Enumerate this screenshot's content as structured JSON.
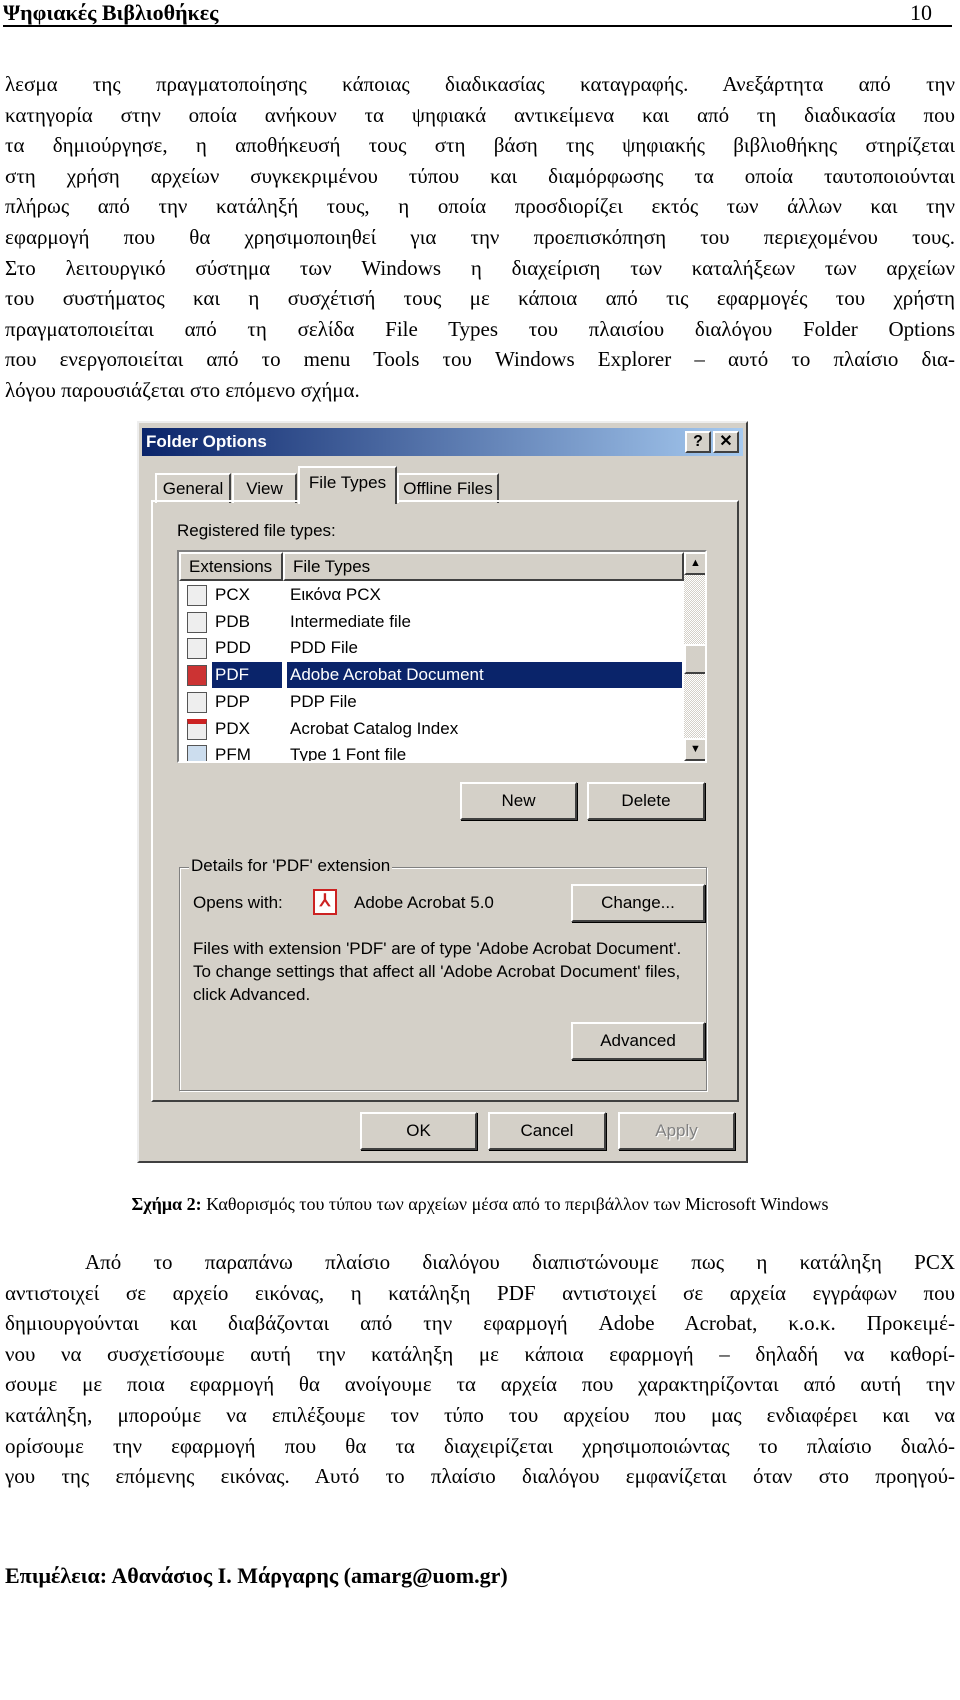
{
  "header": {
    "title": "Ψηφιακές Βιβλιοθήκες",
    "page_number": "10"
  },
  "paragraph1": [
    "λεσμα της πραγματοποίησης κάποιας διαδικασίας καταγραφής. Ανεξάρτητα από την",
    "κατηγορία στην οποία ανήκουν τα ψηφιακά αντικείμενα και από τη διαδικασία που",
    "τα δημιούργησε, η αποθήκευσή τους στη βάση της ψηφιακής βιβλιοθήκης στηρίζεται",
    "στη χρήση αρχείων συγκεκριμένου τύπου και διαμόρφωσης τα οποία ταυτοποιούνται",
    "πλήρως από την κατάληξή τους, η οποία προσδιορίζει εκτός των άλλων και την",
    "εφαρμογή που θα χρησιμοποιηθεί για την προεπισκόπηση του περιεχομένου τους.",
    "Στο λειτουργικό σύστημα των Windows η διαχείριση των καταλήξεων των αρχείων",
    "του συστήματος και η συσχέτισή τους με κάποια από τις εφαρμογές του χρήστη",
    "πραγματοποιείται από τη σελίδα File Types του πλαισίου διαλόγου Folder Options",
    "που ενεργοποιείται από το menu Tools του Windows Explorer – αυτό το πλαίσιο δια-",
    "λόγου παρουσιάζεται στο επόμενο σχήμα."
  ],
  "dialog": {
    "title": "Folder Options",
    "help_label": "?",
    "close_label": "✕",
    "tabs": [
      {
        "label": "General"
      },
      {
        "label": "View"
      },
      {
        "label": "File Types",
        "selected": true
      },
      {
        "label": "Offline Files"
      }
    ],
    "registered_label": "Registered file types:",
    "columns": [
      "Extensions",
      "File Types"
    ],
    "rows": [
      {
        "ext": "PCX",
        "type": "Εικόνα PCX",
        "icon": "image-file-icon"
      },
      {
        "ext": "PDB",
        "type": "Intermediate file",
        "icon": "generic-file-icon"
      },
      {
        "ext": "PDD",
        "type": "PDD File",
        "icon": "checked-file-icon"
      },
      {
        "ext": "PDF",
        "type": "Adobe Acrobat Document",
        "icon": "acrobat-document-icon",
        "selected": true
      },
      {
        "ext": "PDP",
        "type": "PDP File",
        "icon": "acrobat-file-icon"
      },
      {
        "ext": "PDX",
        "type": "Acrobat Catalog Index",
        "icon": "catalog-index-icon"
      },
      {
        "ext": "PFM",
        "type": "Type 1 Font file",
        "icon": "font-file-icon"
      }
    ],
    "new_label": "New",
    "delete_label": "Delete",
    "details_label": "Details for 'PDF' extension",
    "opens_with_label": "Opens with:",
    "opens_with_app": "Adobe Acrobat 5.0",
    "change_label": "Change...",
    "description": [
      "Files with extension 'PDF' are of type 'Adobe Acrobat Document'.",
      "To change settings that affect all 'Adobe Acrobat Document' files,",
      "click Advanced."
    ],
    "advanced_label": "Advanced",
    "ok_label": "OK",
    "cancel_label": "Cancel",
    "apply_label": "Apply",
    "selection_color": "#0a246a"
  },
  "caption": {
    "label": "Σχήμα 2:",
    "text": " Καθορισμός του τύπου των αρχείων μέσα από το περιβάλλον των Microsoft Windows"
  },
  "paragraph2": [
    "Από το παραπάνω πλαίσιο διαλόγου διαπιστώνουμε πως η κατάληξη PCX",
    "αντιστοιχεί σε αρχείο εικόνας, η κατάληξη PDF αντιστοιχεί σε αρχεία εγγράφων που",
    "δημιουργούνται και διαβάζονται από την εφαρμογή Adobe Acrobat, κ.ο.κ. Προκειμέ-",
    "νου να συσχετίσουμε αυτή την κατάληξη με κάποια εφαρμογή – δηλαδή να καθορί-",
    "σουμε με ποια εφαρμογή θα ανοίγουμε τα αρχεία που χαρακτηρίζονται από αυτή την",
    "κατάληξη, μπορούμε να επιλέξουμε τον τύπο του αρχείου που μας ενδιαφέρει και να",
    "ορίσουμε την εφαρμογή που θα τα διαχειρίζεται χρησιμοποιώντας το πλαίσιο διαλό-",
    "γου της επόμενης εικόνας. Αυτό το πλαίσιο διαλόγου εμφανίζεται όταν στο προηγού-"
  ],
  "footer": {
    "text": "Επιμέλεια: Αθανάσιος Ι. Μάργαρης (amarg@uom.gr)"
  }
}
